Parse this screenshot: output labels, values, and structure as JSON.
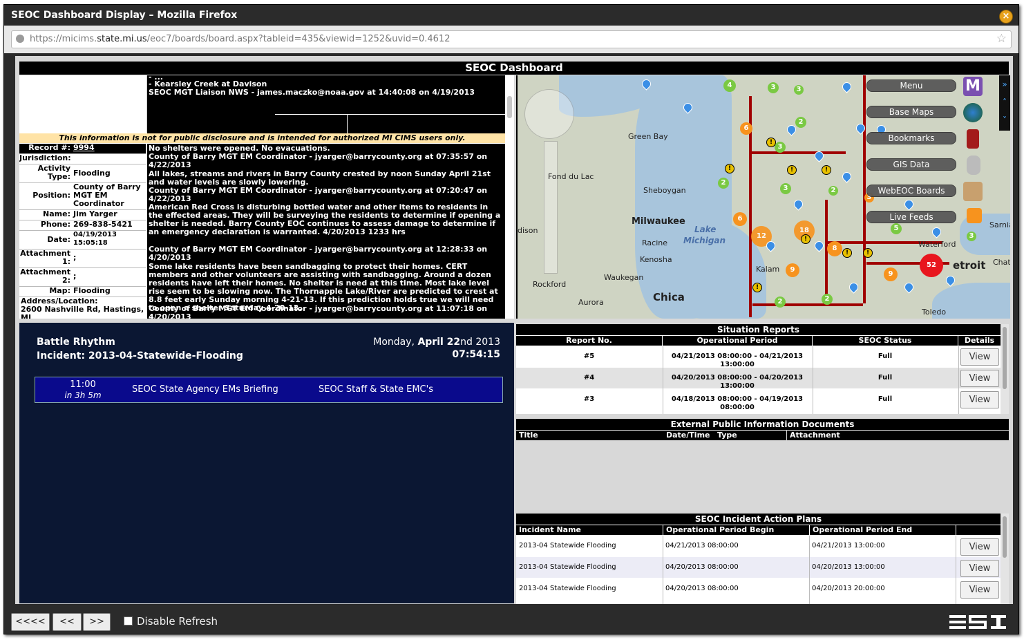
{
  "window": {
    "title": "SEOC Dashboard Display – Mozilla Firefox"
  },
  "url": {
    "prefix": "https://micims.",
    "host": "state.mi.us",
    "path": "/eoc7/boards/board.aspx?tableid=435&viewid=1252&uvid=0.4612"
  },
  "dashboard": {
    "title": "SEOC Dashboard"
  },
  "record": {
    "top_lines": [
      "- Kearsley Creek at Davison",
      "SEOC MGT Liaison NWS - james.maczko@noaa.gov at 14:40:08 on 4/19/2013"
    ],
    "disclaimer": "This information is not for public disclosure and is intended for authorized MI CIMS users only.",
    "fields": [
      {
        "label": "Record #:",
        "value": "9994"
      },
      {
        "label": "Jurisdiction:",
        "value": ""
      },
      {
        "label": "Activity Type:",
        "value": "Flooding"
      },
      {
        "label": "Position:",
        "value": "County of Barry MGT EM Coordinator"
      },
      {
        "label": "Name:",
        "value": "Jim Yarger"
      },
      {
        "label": "Phone:",
        "value": "269-838-5421"
      },
      {
        "label": "Date:",
        "value": "04/19/2013 15:05:18"
      },
      {
        "label": "Attachment 1:",
        "value": ";"
      },
      {
        "label": "Attachment 2:",
        "value": ";"
      },
      {
        "label": "Map:",
        "value": "Flooding"
      },
      {
        "label": "Address/Location:",
        "value": "2600 Nashville Rd, Hastings, MI"
      }
    ],
    "updates": [
      "No shelters were opened. No evacuations.",
      "County of Barry MGT EM Coordinator - jyarger@barrycounty.org at 07:35:57 on 4/22/2013",
      "All lakes, streams and rivers in Barry County crested by noon Sunday April 21st and water levels are slowly lowering.",
      "County of Barry MGT EM Coordinator - jyarger@barrycounty.org at 07:20:47 on 4/22/2013",
      "American Red Cross is disturbing bottled water and other items to residents in the effected areas. They will be surveying the residents to determine if opening a shelter is needed. Barry County EOC continues to assess damage to determine if an emergency declaration is warranted. 4/20/2013 1233 hrs",
      "County of Barry MGT EM Coordinator - jyarger@barrycounty.org at 12:28:33 on 4/20/2013",
      "Some lake residents have been sandbagging to protect their homes. CERT members and other volunteers are assisting with sandbagging. Around a dozen residents have left their homes. No shelter is need at this time. Most lake level rise seem to be slowing now. The Thornapple Lake/River are predicted to crest at 8.8 feet early Sunday morning 4-21-13. If this prediction holds true we will need to open a shelter Saturday 4-20-13.",
      "County of Barry MGT EM Coordinator - jyarger@barrycounty.org at 11:07:18 on 4/20/2013"
    ]
  },
  "map": {
    "buttons": [
      "Menu",
      "Base Maps",
      "Bookmarks",
      "GIS Data",
      "WebEOC Boards",
      "Live Feeds"
    ],
    "labels": {
      "green_bay": "Green Bay",
      "fond_du_lac": "Fond du Lac",
      "sheboygan": "Sheboygan",
      "milwaukee": "Milwaukee",
      "racine": "Racine",
      "kenosha": "Kenosha",
      "waukegan": "Waukegan",
      "rockford": "Rockford",
      "aurora": "Aurora",
      "chicago": "Chica",
      "lake1": "Lake",
      "lake2": "Michigan",
      "waterford": "Waterford",
      "detroit": "etroit",
      "toledo": "Toledo",
      "kalamazoo": "Kalam",
      "sarnia": "Sarnia",
      "dison": "dison",
      "chat": "Chat"
    },
    "clusters": [
      "3",
      "4",
      "3",
      "6",
      "2",
      "3",
      "2",
      "3",
      "2",
      "3",
      "6",
      "12",
      "18",
      "8",
      "9",
      "5",
      "3",
      "52",
      "2",
      "9",
      "2"
    ]
  },
  "battle": {
    "title": "Battle Rhythm",
    "incident": "Incident: 2013-04-Statewide-Flooding",
    "date_prefix": "Monday, ",
    "date_bold": "April 22",
    "date_suffix": "nd 2013",
    "time": "07:54:15",
    "event": {
      "time": "11:00",
      "in": "in 3h 5m",
      "name": "SEOC State Agency EMs Briefing",
      "who": "SEOC Staff & State EMC's"
    }
  },
  "situation": {
    "title": "Situation Reports",
    "columns": [
      "Report No.",
      "Operational Period",
      "SEOC Status",
      "Details"
    ],
    "rows": [
      {
        "no": "#5",
        "period": "04/21/2013 08:00:00  - 04/21/2013 13:00:00",
        "status": "Full",
        "btn": "View"
      },
      {
        "no": "#4",
        "period": "04/20/2013 08:00:00  - 04/20/2013 13:00:00",
        "status": "Full",
        "btn": "View"
      },
      {
        "no": "#3",
        "period": "04/18/2013 08:00:00  - 04/19/2013 08:00:00",
        "status": "Full",
        "btn": "View"
      }
    ]
  },
  "external": {
    "title": "External Public Information Documents",
    "columns": [
      "Title",
      "Date/Time",
      "Type",
      "Attachment"
    ]
  },
  "iap": {
    "title": "SEOC Incident Action Plans",
    "columns": [
      "Incident Name",
      "Operational Period Begin",
      "Operational Period End"
    ],
    "rows": [
      {
        "name": "2013-04 Statewide Flooding",
        "begin": "04/21/2013 08:00:00",
        "end": "04/21/2013 13:00:00",
        "btn": "View"
      },
      {
        "name": "2013-04 Statewide Flooding",
        "begin": "04/20/2013 08:00:00",
        "end": "04/20/2013 13:00:00",
        "btn": "View"
      },
      {
        "name": "2013-04 Statewide Flooding",
        "begin": "04/20/2013 08:00:00",
        "end": "04/20/2013 20:00:00",
        "btn": "View"
      }
    ]
  },
  "footer": {
    "first": "<<<<",
    "prev": "<<",
    "next": ">>",
    "disable_refresh": "Disable Refresh",
    "logo_text": "ESI"
  },
  "colors": {
    "header_bg": "#000000",
    "battle_bg": "#0b1733",
    "event_bg": "#0a0a8c",
    "disclaimer_bg": "#ffe3a6",
    "route": "#a00000"
  }
}
